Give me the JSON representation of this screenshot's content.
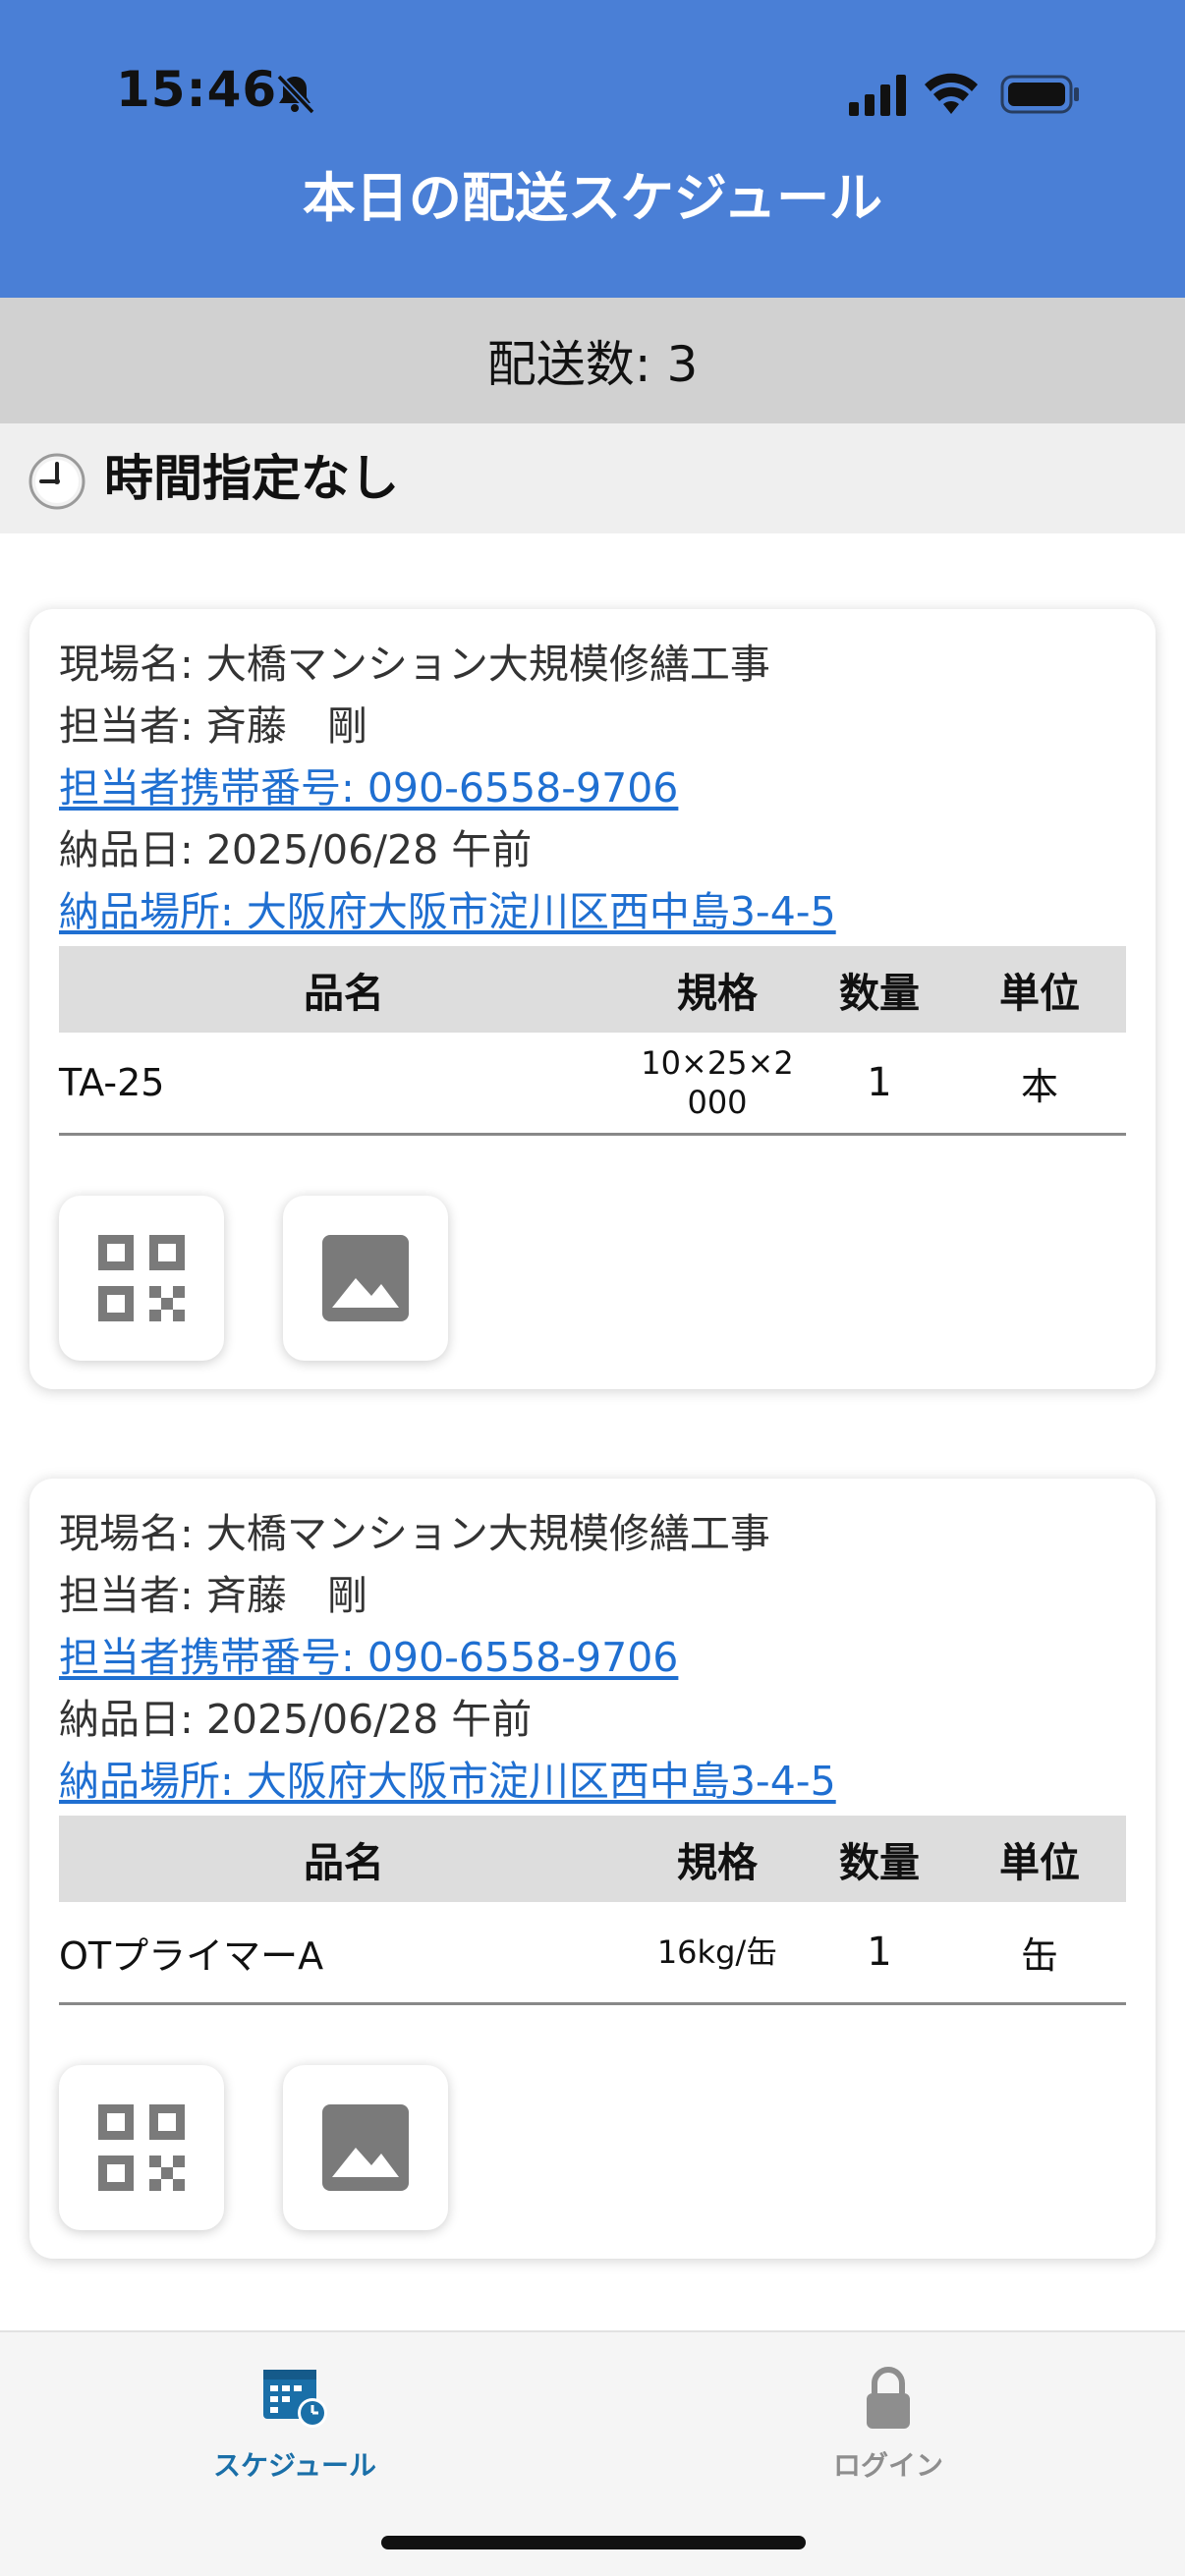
{
  "status_bar": {
    "time": "15:46",
    "icons": [
      "bell-slash-icon",
      "cellular-signal-icon",
      "wifi-icon",
      "battery-icon"
    ]
  },
  "header": {
    "title": "本日の配送スケジュール",
    "background_color": "#4a7fd6"
  },
  "summary": {
    "count_label": "配送数: 3"
  },
  "section": {
    "icon": "clock-icon",
    "label": "時間指定なし"
  },
  "table_headers": {
    "name": "品名",
    "spec": "規格",
    "qty": "数量",
    "unit": "単位"
  },
  "cards": [
    {
      "site": "現場名: 大橋マンション大規模修繕工事",
      "person": "担当者: 斉藤　剛",
      "phone": "担当者携帯番号: 090-6558-9706",
      "date": "納品日: 2025/06/28 午前",
      "place": "納品場所: 大阪府大阪市淀川区西中島3-4-5",
      "item": {
        "name": "TA-25",
        "spec": "10×25×2000",
        "qty": "1",
        "unit": "本"
      },
      "buttons": [
        "qr-code-icon",
        "image-icon"
      ]
    },
    {
      "site": "現場名: 大橋マンション大規模修繕工事",
      "person": "担当者: 斉藤　剛",
      "phone": "担当者携帯番号: 090-6558-9706",
      "date": "納品日: 2025/06/28 午前",
      "place": "納品場所: 大阪府大阪市淀川区西中島3-4-5",
      "item": {
        "name": "OTプライマーA",
        "spec": "16kg/缶",
        "qty": "1",
        "unit": "缶"
      },
      "buttons": [
        "qr-code-icon",
        "image-icon"
      ]
    }
  ],
  "tabbar": {
    "items": [
      {
        "label": "スケジュール",
        "icon": "calendar-clock-icon",
        "active": true,
        "color": "#1a6fa8"
      },
      {
        "label": "ログイン",
        "icon": "lock-icon",
        "active": false,
        "color": "#8e8e8e"
      }
    ]
  }
}
